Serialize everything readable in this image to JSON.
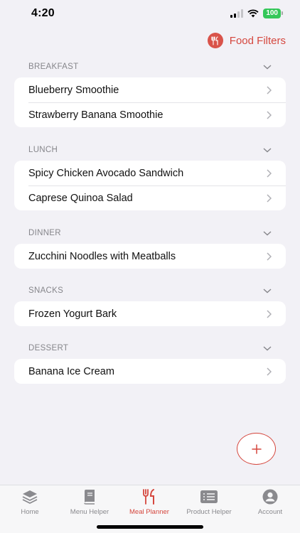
{
  "status": {
    "time": "4:20",
    "battery": "100",
    "signal_icon": "cellular-signal-icon",
    "wifi_icon": "wifi-icon"
  },
  "header": {
    "filters_label": "Food Filters",
    "filters_icon": "fork-knife-icon",
    "accent_color": "#d5473e"
  },
  "sections": [
    {
      "title": "BREAKFAST",
      "items": [
        "Blueberry Smoothie",
        "Strawberry Banana Smoothie"
      ]
    },
    {
      "title": "LUNCH",
      "items": [
        "Spicy Chicken Avocado Sandwich",
        "Caprese Quinoa Salad"
      ]
    },
    {
      "title": "DINNER",
      "items": [
        "Zucchini Noodles with Meatballs"
      ]
    },
    {
      "title": "SNACKS",
      "items": [
        "Frozen Yogurt Bark"
      ]
    },
    {
      "title": "DESSERT",
      "items": [
        "Banana Ice Cream"
      ]
    }
  ],
  "fab": {
    "icon": "plus-icon"
  },
  "tabs": [
    {
      "label": "Home",
      "icon": "layers-icon",
      "active": false
    },
    {
      "label": "Menu Helper",
      "icon": "book-icon",
      "active": false
    },
    {
      "label": "Meal Planner",
      "icon": "fork-knife-icon",
      "active": true
    },
    {
      "label": "Product Helper",
      "icon": "list-icon",
      "active": false
    },
    {
      "label": "Account",
      "icon": "person-circle-icon",
      "active": false
    }
  ]
}
